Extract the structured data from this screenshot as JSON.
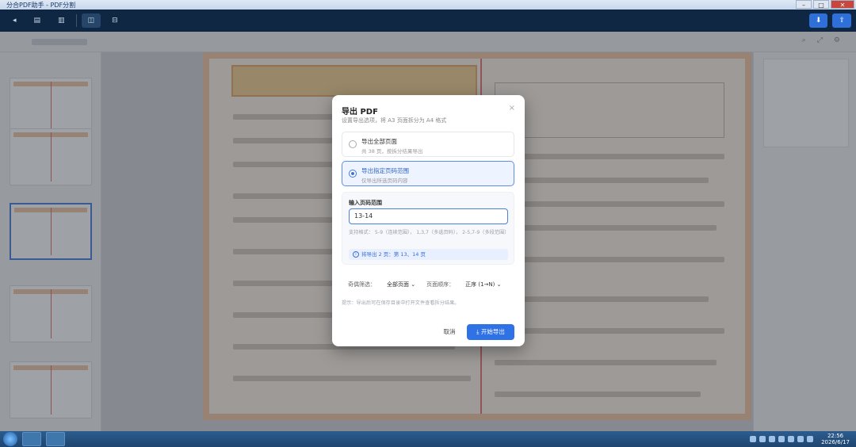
{
  "window": {
    "title": "分合PDF助手 - PDF分割"
  },
  "dialog": {
    "title": "导出 PDF",
    "subtitle": "设置导出选项，将 A3 页面拆分为 A4 格式",
    "close_label": "×",
    "option_all": {
      "title": "导出全部页面",
      "desc": "共 38 页，按拆分结果导出"
    },
    "option_range": {
      "title": "导出指定页码范围",
      "desc": "仅导出所选页码内容"
    },
    "range": {
      "label": "输入页码范围",
      "value": "13-14",
      "hint": "支持格式：  5-9（连续范围），  1,3,7（多选页码），  2-5,7-9（多段范围）",
      "info": "将导出 2 页：第 13、14 页"
    },
    "settings": {
      "odd_even_label": "奇偶筛选：",
      "odd_even_value": "全部页面",
      "order_label": "页面顺序：",
      "order_value": "正序 (1→N)"
    },
    "note": "提示：导出后可在保存目录中打开文件查看拆分结果。",
    "cancel_label": "取消",
    "export_label": "开始导出"
  },
  "taskbar": {
    "time": "22:56",
    "date": "2026/6/17"
  }
}
